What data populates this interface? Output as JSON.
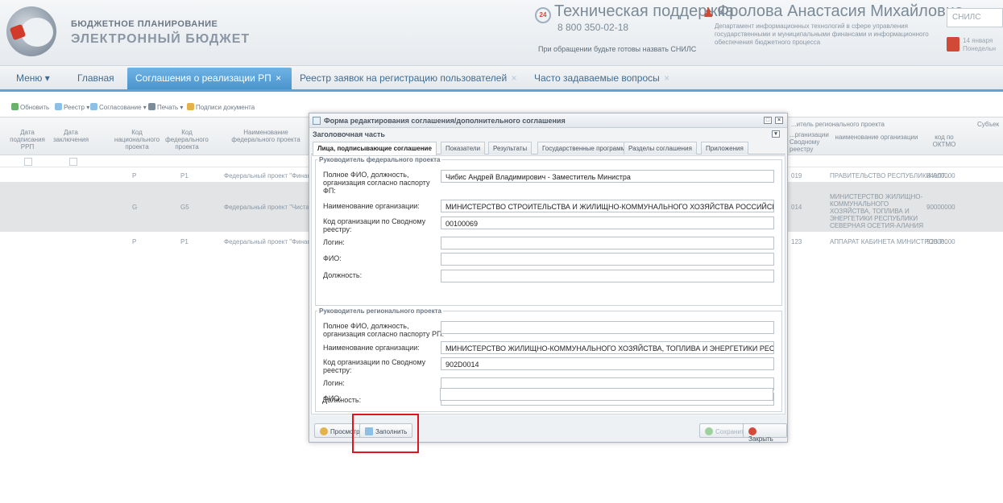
{
  "header": {
    "logo_line1": "БЮДЖЕТНОЕ ПЛАНИРОВАНИЕ",
    "logo_line2": "ЭЛЕКТРОННЫЙ БЮДЖЕТ",
    "support_badge": "24",
    "support_title": "Техническая поддержка",
    "support_phone": "8 800 350-02-18",
    "support_note": "При обращении будьте готовы назвать СНИЛС",
    "user_name": "Фролова Анастасия Михайловна",
    "user_dept": "Департамент информационных технологий в сфере управления государственными и муниципальными финансами и информационного обеспечения бюджетного процесса",
    "snils_placeholder": "СНИЛС",
    "date_line1": "14 января",
    "date_line2": "Понедельн"
  },
  "nav": {
    "menu": "Меню ▾",
    "home": "Главная",
    "tabs": [
      {
        "label": "Соглашения о реализации РП"
      },
      {
        "label": "Реестр заявок на регистрацию пользователей"
      },
      {
        "label": "Часто задаваемые вопросы"
      }
    ],
    "close": "×"
  },
  "toolbar": {
    "refresh": "Обновить",
    "registry": "Реестр ▾",
    "approval": "Согласование ▾",
    "print": "Печать ▾",
    "sign": "Подписи документа"
  },
  "grid": {
    "headers": [
      "Дата подписания РРП",
      "Дата заключения",
      "Код национального проекта",
      "Код федерального проекта",
      "Наименование федерального проекта"
    ],
    "right_group_header": "...итель регионального проекта",
    "right_headers": [
      "...рганизации Сводному реестру",
      "наименование организации",
      "код по ОКТМО",
      "Субъек"
    ],
    "rows": [
      {
        "nat": "P",
        "fed": "P1",
        "name": "Федеральный проект \"Финанс",
        "code": "019",
        "org": "ПРАВИТЕЛЬСТВО РЕСПУБЛИКИ АЛТ...",
        "oktmo": "84000000"
      },
      {
        "nat": "G",
        "fed": "G5",
        "name": "Федеральный проект \"Чистая",
        "code": "014",
        "org": "МИНИСТЕРСТВО ЖИЛИЩНО-КОММУНАЛЬНОГО ХОЗЯЙСТВА, ТОПЛИВА И ЭНЕРГЕТИКИ РЕСПУБЛИКИ СЕВЕРНАЯ ОСЕТИЯ-АЛАНИЯ",
        "oktmo": "90000000"
      },
      {
        "nat": "P",
        "fed": "P1",
        "name": "Федеральный проект \"Финанс",
        "code": "123",
        "org": "АППАРАТ КАБИНЕТА МИНИСТРОВ Р...",
        "oktmo": "92000000"
      }
    ]
  },
  "dialog": {
    "title": "Форма редактирования соглашения/дополнительного соглашения",
    "section": "Заголовочная часть",
    "tabs": [
      "Лица, подписывающие соглашение",
      "Показатели",
      "Результаты",
      "Государственные программы",
      "Разделы соглашения",
      "Приложения"
    ],
    "federal": {
      "legend": "Руководитель федерального проекта",
      "fio_label": "Полное ФИО, должность, организация согласно паспорту ФП:",
      "fio_value": "Чибис Андрей Владимирович - Заместитель Министра",
      "org_label": "Наименование организации:",
      "org_value": "МИНИСТЕРСТВО СТРОИТЕЛЬСТВА И ЖИЛИЩНО-КОММУНАЛЬНОГО ХОЗЯЙСТВА РОССИЙСКОЙ ФЕДЕРАЦИ",
      "code_label": "Код организации по Сводному реестру:",
      "code_value": "00100069",
      "login_label": "Логин:",
      "login_value": "",
      "name_label": "ФИО:",
      "name_value": "",
      "position_label": "Должность:",
      "position_value": ""
    },
    "regional": {
      "legend": "Руководитель регионального проекта",
      "fio_label": "Полное ФИО, должность, организация согласно паспорту РП:",
      "fio_value": "",
      "org_label": "Наименование организации:",
      "org_value": "МИНИСТЕРСТВО ЖИЛИЩНО-КОММУНАЛЬНОГО ХОЗЯЙСТВА, ТОПЛИВА И ЭНЕРГЕТИКИ РЕСПУБЛИКИ СЕЕ",
      "code_label": "Код организации по Сводному реестру:",
      "code_value": "902D0014",
      "login_label": "Логин:",
      "login_value": "",
      "name_label": "ФИО:",
      "name_value": "",
      "position_label": "Должность:",
      "position_value": ""
    },
    "buttons": {
      "view": "Просмотр",
      "fill": "Заполнить",
      "save": "Сохранить",
      "close": "Закрыть"
    },
    "highlight_color": "#e0141e"
  }
}
